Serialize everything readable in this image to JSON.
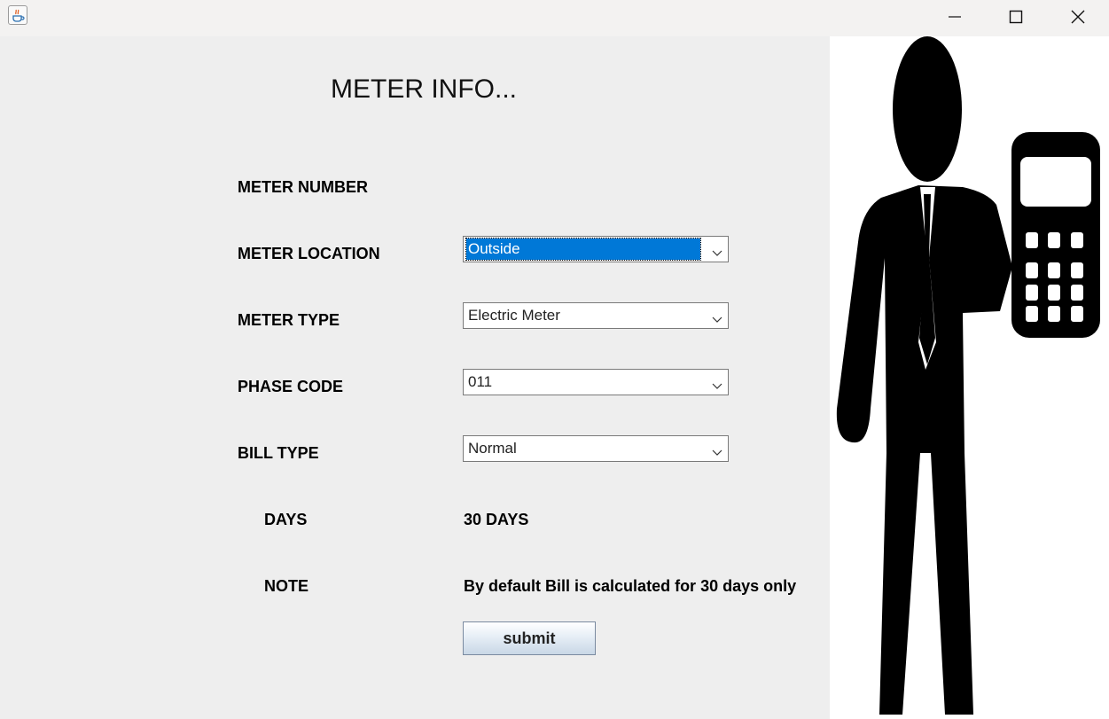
{
  "window": {
    "app_icon": "java-cup-icon",
    "minimize_icon": "minimize-icon",
    "maximize_icon": "maximize-icon",
    "close_icon": "close-icon"
  },
  "heading": "METER INFO...",
  "form": {
    "meter_number_label": "METER NUMBER",
    "meter_location_label": "METER LOCATION",
    "meter_location_value": "Outside",
    "meter_type_label": "METER TYPE",
    "meter_type_value": "Electric Meter",
    "phase_code_label": "PHASE CODE",
    "phase_code_value": "011",
    "bill_type_label": "BILL TYPE",
    "bill_type_value": "Normal",
    "days_label": "DAYS",
    "days_value": "30 DAYS",
    "note_label": "NOTE",
    "note_value": "By default Bill is calculated for 30 days only",
    "submit_label": "submit"
  },
  "illustration": {
    "icon": "businessman-with-calculator-icon"
  },
  "colors": {
    "window_bg": "#eeeeee",
    "titlebar_bg": "#f3f2f1",
    "selection": "#0078d7",
    "image_bg": "#ffffff"
  }
}
